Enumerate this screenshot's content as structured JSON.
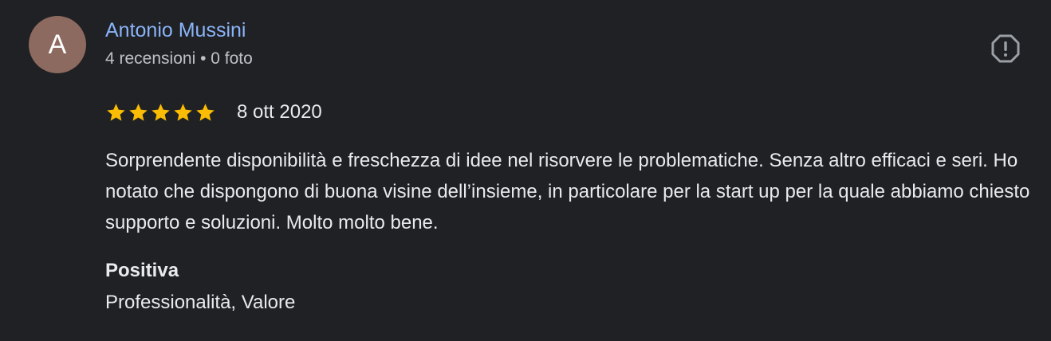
{
  "author": {
    "avatar_letter": "A",
    "avatar_color": "#8d6a5f",
    "name": "Antonio Mussini",
    "name_color": "#8ab4f8",
    "meta": "4 recensioni • 0 foto"
  },
  "report": {
    "icon": "report-icon"
  },
  "rating": {
    "stars": 5,
    "max_stars": 5,
    "star_color": "#fbbc04",
    "date": "8 ott 2020"
  },
  "review": {
    "text": "Sorprendente disponibilità e freschezza di idee nel risorvere le problematiche. Senza altro efficaci e seri. Ho notato che dispongono di buona visine dell’insieme, in particolare per la start up per la quale abbiamo chiesto supporto e soluzioni. Molto molto bene."
  },
  "aspects": {
    "label": "Positiva",
    "values": "Professionalità, Valore"
  },
  "theme": {
    "background": "#202124",
    "text": "#e8eaed",
    "secondary_text": "#bdc1c6"
  }
}
